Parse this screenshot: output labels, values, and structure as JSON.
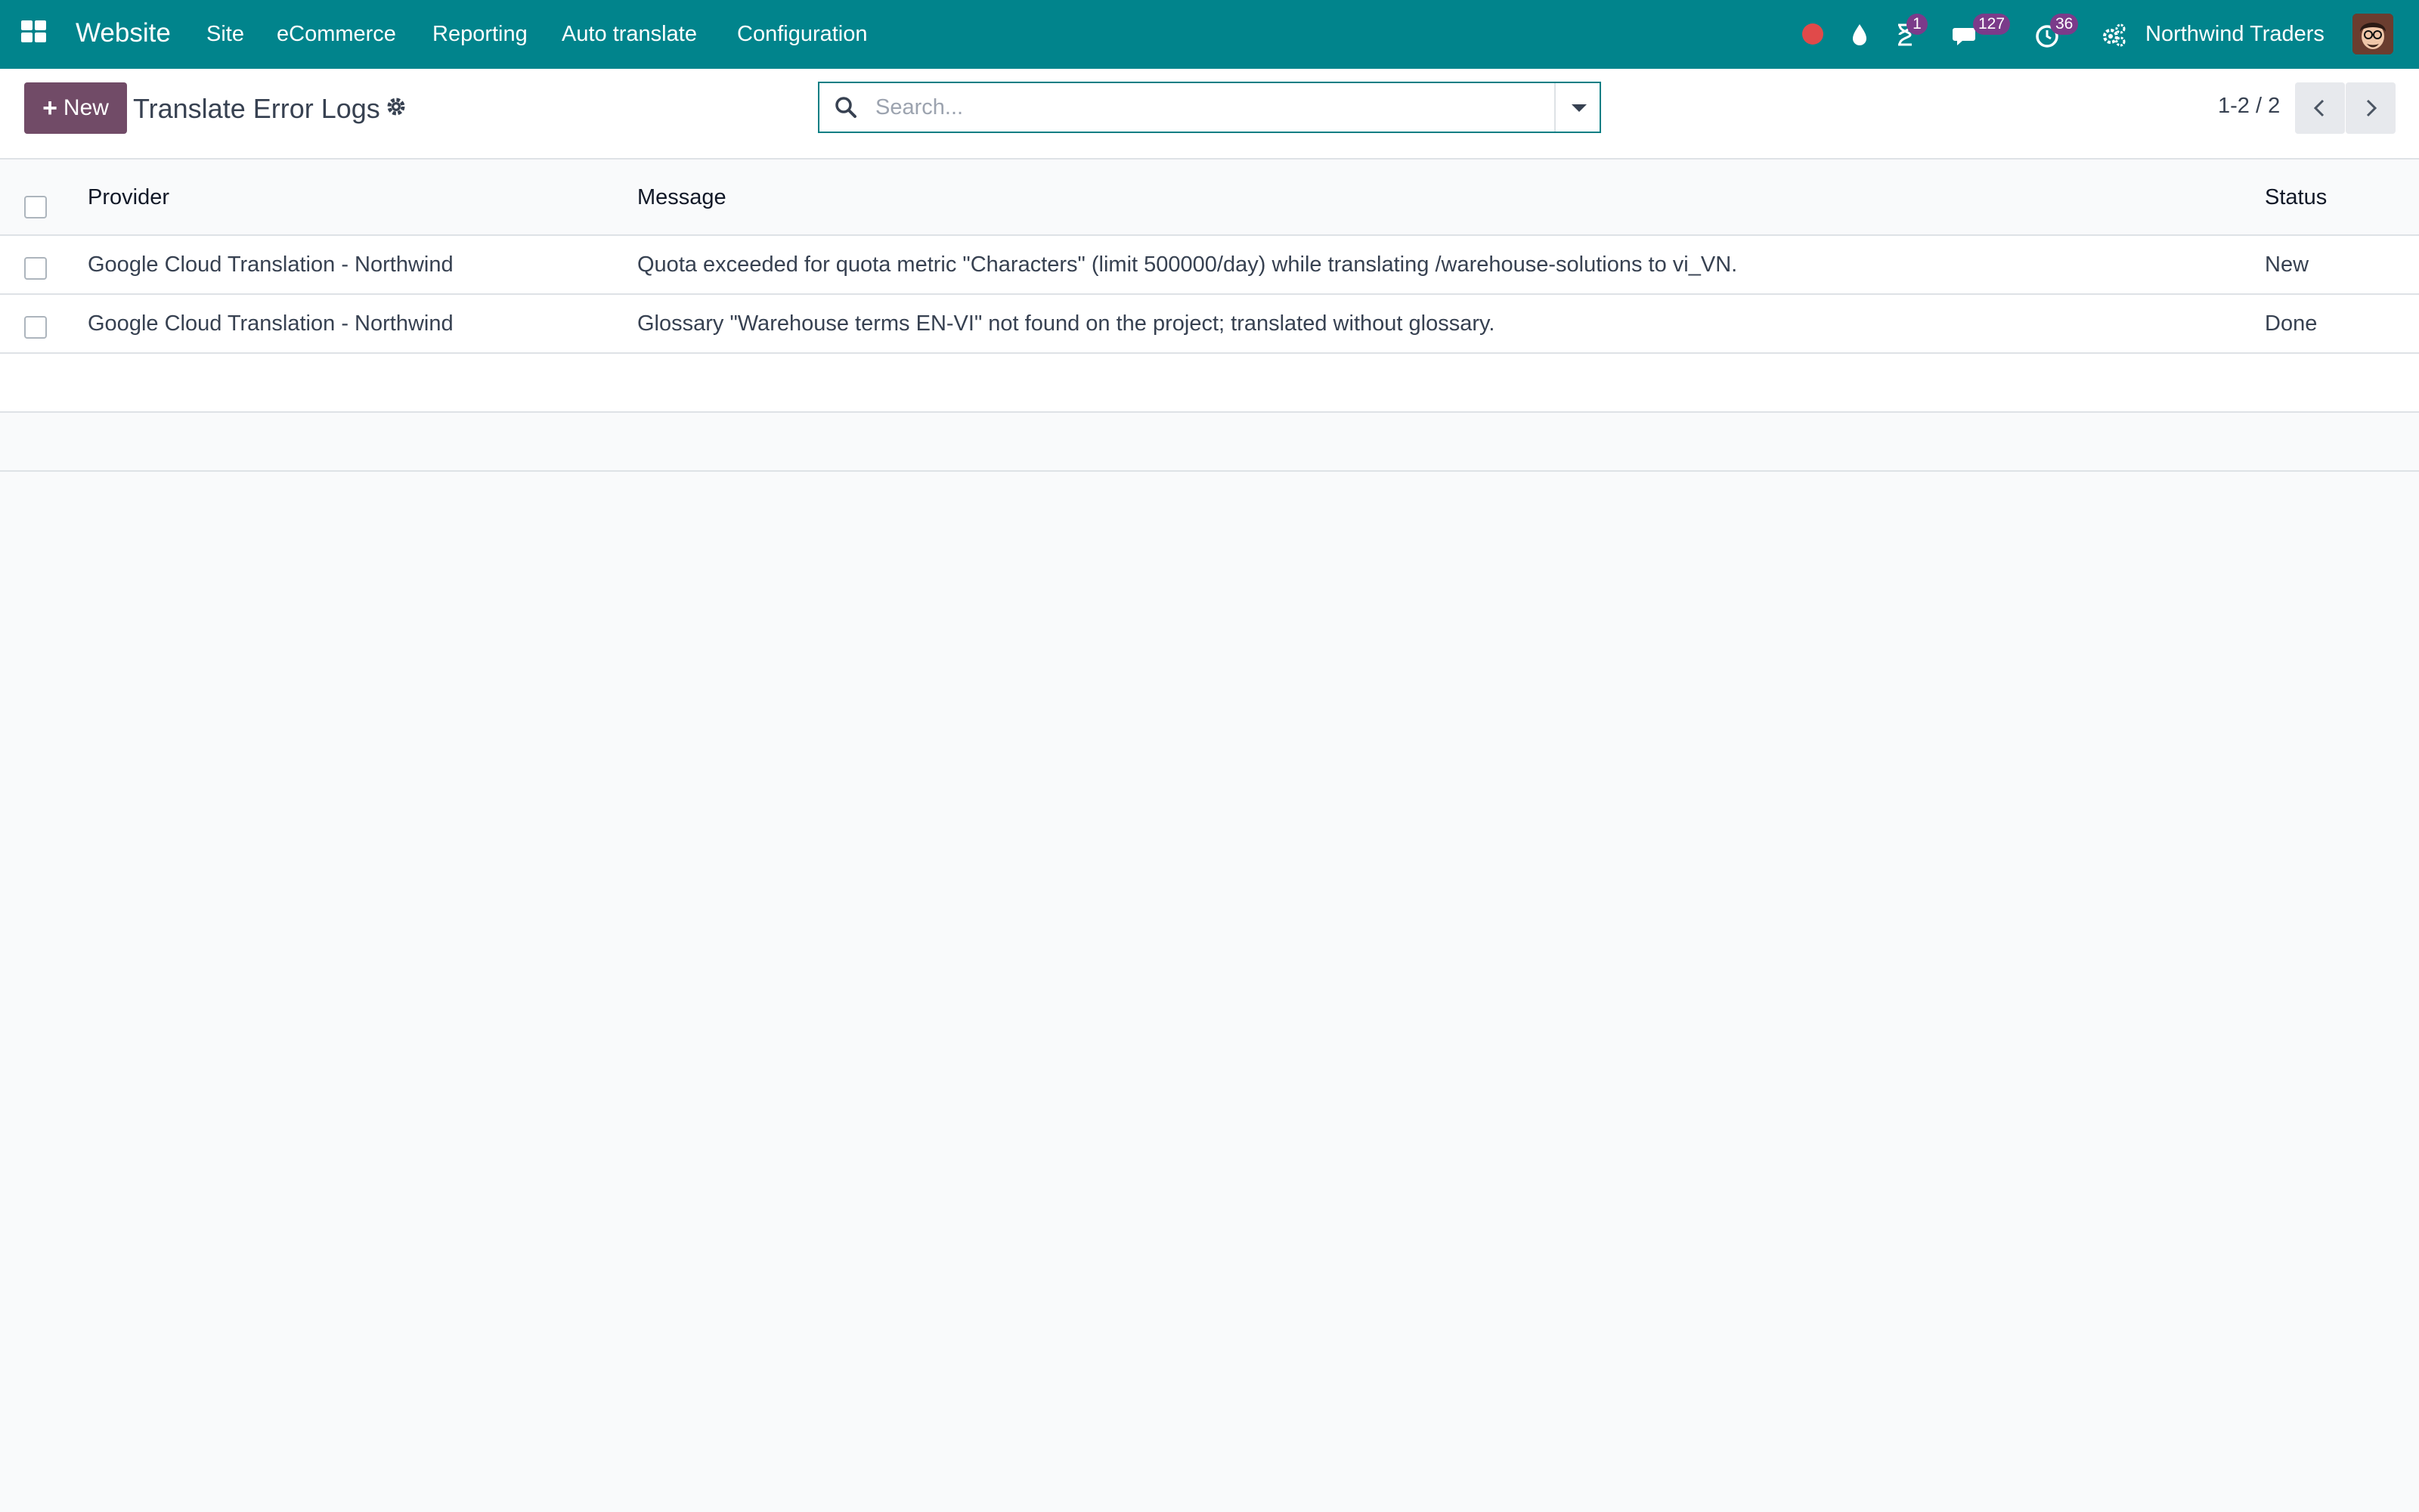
{
  "navbar": {
    "brand": "Website",
    "menu": [
      "Site",
      "eCommerce",
      "Reporting",
      "Auto translate",
      "Configuration"
    ],
    "badges": {
      "activities": "1",
      "messages": "127",
      "clock": "36"
    },
    "company": "Northwind Traders",
    "colors": {
      "bar": "#01848c",
      "badge": "#7b3b8a",
      "recording_dot": "#e04a4a"
    }
  },
  "control": {
    "new_label": "New",
    "title": "Translate Error Logs",
    "search_placeholder": "Search...",
    "pager": "1-2 / 2"
  },
  "table": {
    "columns": {
      "provider": "Provider",
      "message": "Message",
      "status": "Status"
    },
    "rows": [
      {
        "provider": "Google Cloud Translation - Northwind",
        "message": "Quota exceeded for quota metric \"Characters\" (limit 500000/day) while translating /warehouse-solutions to vi_VN.",
        "status": "New"
      },
      {
        "provider": "Google Cloud Translation - Northwind",
        "message": "Glossary \"Warehouse terms EN-VI\" not found on the project; translated without glossary.",
        "status": "Done"
      }
    ]
  }
}
